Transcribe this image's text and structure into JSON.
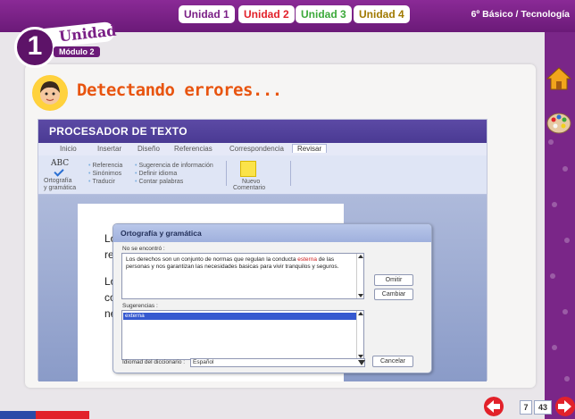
{
  "topbar": {
    "units": [
      "Unidad 1",
      "Unidad 2",
      "Unidad 3",
      "Unidad 4"
    ],
    "grade": "6º Básico / Tecnología"
  },
  "badge": {
    "number": "1",
    "unidad": "Unidad",
    "modulo": "Módulo 2"
  },
  "page": {
    "title": "Detectando errores..."
  },
  "word_processor": {
    "title": "PROCESADOR DE TEXTO",
    "tabs": [
      "Inicio",
      "Insertar",
      "Diseño",
      "Referencias",
      "Correspondencia",
      "Revisar"
    ],
    "active_tab": "Revisar",
    "ribbon": {
      "abc": "ABC",
      "spell_label_1": "Ortografía",
      "spell_label_2": "y gramática",
      "col1": [
        "Referencia",
        "Sinónimos",
        "Traducir"
      ],
      "col2": [
        "Sugerencia de información",
        "Definir idioma",
        "Contar palabras"
      ],
      "comment_1": "Nuevo",
      "comment_2": "Comentario"
    },
    "doc_fragments": [
      "Lo",
      "re",
      "Lo",
      "co",
      "ne"
    ]
  },
  "dialog": {
    "title": "Ortografía y gramática",
    "not_found_label": "No se encontró :",
    "text_before": "Los derechos son un conjunto de normas que regulan la conducta ",
    "error_word": "esterna",
    "text_after": " de las personas y nos garantizan las necesidades basicas para vivir tranquilos y seguros.",
    "suggestions_label": "Sugerencias :",
    "suggestion": "externa",
    "dictionary_label": "Idiomad del diccionario :",
    "dictionary_value": "Español",
    "buttons": {
      "omit": "Omitir",
      "change": "Cambiar",
      "cancel": "Cancelar"
    }
  },
  "pagination": {
    "current": "7",
    "total": "43"
  },
  "colors": {
    "purple": "#6b1a78",
    "orange": "#e8540f",
    "red": "#e2212a",
    "blue": "#3559d0"
  }
}
